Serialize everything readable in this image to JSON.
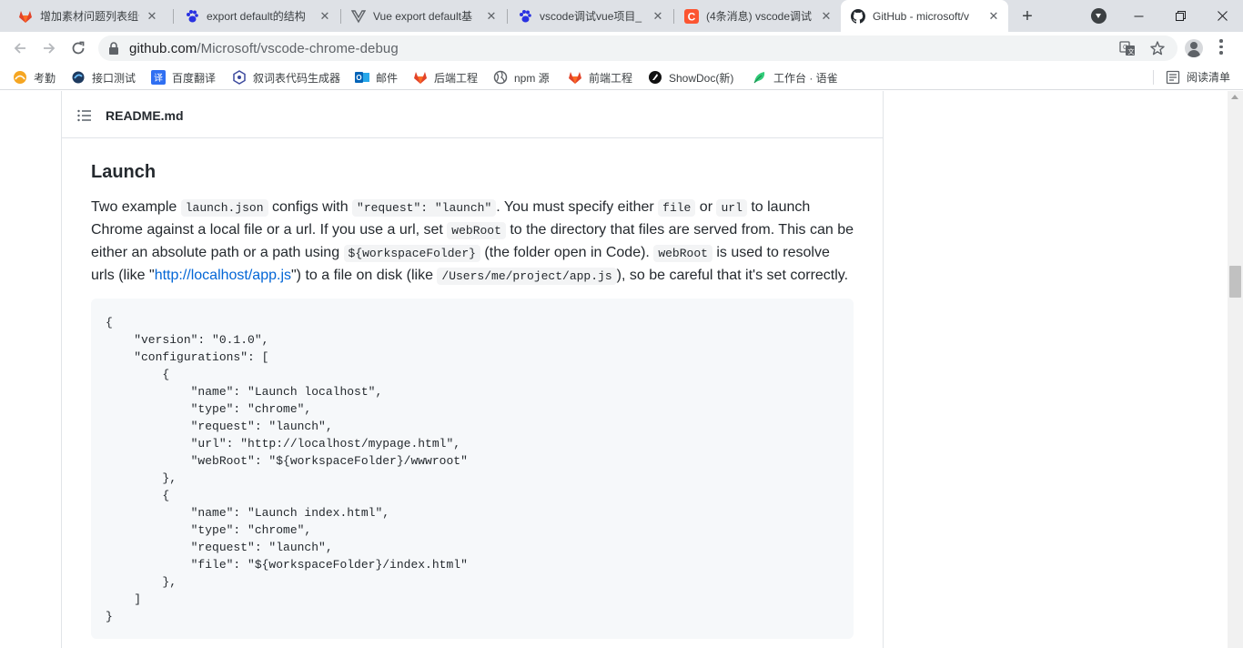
{
  "tabs": [
    {
      "title": "增加素材问题列表组件",
      "icon": "gitlab-icon",
      "active": false
    },
    {
      "title": "export default的结构",
      "icon": "baidu-paw-icon",
      "active": false
    },
    {
      "title": "Vue export default基",
      "icon": "vue-icon",
      "active": false
    },
    {
      "title": "vscode调试vue项目_",
      "icon": "baidu-paw-icon",
      "active": false
    },
    {
      "title": "(4条消息) vscode调试",
      "icon": "csdn-icon",
      "active": false
    },
    {
      "title": "GitHub - microsoft/v",
      "icon": "github-icon",
      "active": true
    }
  ],
  "new_tab_label": "+",
  "address": {
    "host": "github.com",
    "path": "/Microsoft/vscode-chrome-debug"
  },
  "bookmarks": [
    {
      "label": "考勤",
      "icon": "attendance-icon"
    },
    {
      "label": "接口测试",
      "icon": "api-test-icon"
    },
    {
      "label": "百度翻译",
      "icon": "baidu-translate-icon"
    },
    {
      "label": "叙词表代码生成器",
      "icon": "generator-icon"
    },
    {
      "label": "邮件",
      "icon": "outlook-mail-icon"
    },
    {
      "label": "后端工程",
      "icon": "gitlab-icon"
    },
    {
      "label": "npm 源",
      "icon": "globe-icon"
    },
    {
      "label": "前端工程",
      "icon": "gitlab-icon"
    },
    {
      "label": "ShowDoc(新)",
      "icon": "showdoc-icon"
    },
    {
      "label": "工作台 · 语雀",
      "icon": "yuque-icon"
    }
  ],
  "reading_list": "阅读清单",
  "readme": {
    "file_name": "README.md",
    "heading": "Launch",
    "para": {
      "t1": "Two example ",
      "c1": "launch.json",
      "t2": " configs with ",
      "c2": "\"request\": \"launch\"",
      "t3": ". You must specify either ",
      "c3": "file",
      "t4": " or ",
      "c4": "url",
      "t5": " to launch Chrome against a local file or a url. If you use a url, set ",
      "c5": "webRoot",
      "t6": " to the directory that files are served from. This can be either an absolute path or a path using ",
      "c6": "${workspaceFolder}",
      "t7": " (the folder open in Code). ",
      "c7": "webRoot",
      "t8": " is used to resolve urls (like \"",
      "link": "http://localhost/app.js",
      "t9": "\") to a file on disk (like ",
      "c8": "/Users/me/project/app.js",
      "t10": "), so be careful that it's set correctly."
    },
    "code": "{\n    \"version\": \"0.1.0\",\n    \"configurations\": [\n        {\n            \"name\": \"Launch localhost\",\n            \"type\": \"chrome\",\n            \"request\": \"launch\",\n            \"url\": \"http://localhost/mypage.html\",\n            \"webRoot\": \"${workspaceFolder}/wwwroot\"\n        },\n        {\n            \"name\": \"Launch index.html\",\n            \"type\": \"chrome\",\n            \"request\": \"launch\",\n            \"file\": \"${workspaceFolder}/index.html\"\n        },\n    ]\n}"
  },
  "colors": {
    "tabstrip": "#dee1e6",
    "link": "#0366d6",
    "code_bg": "#f6f8fa",
    "inline_code_bg": "#f3f4f5"
  }
}
